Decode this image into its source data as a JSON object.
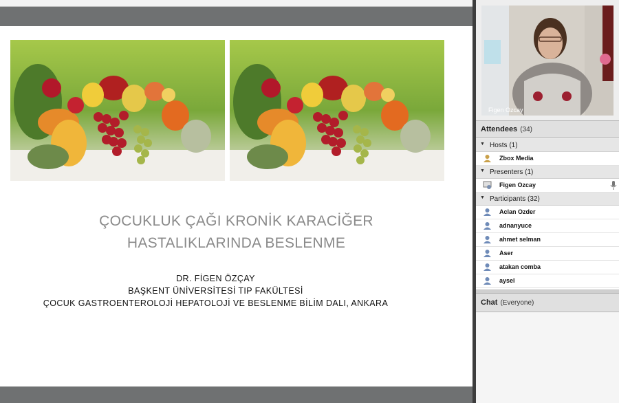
{
  "slide": {
    "title_line1": "ÇOCUKLUK ÇAĞI KRONİK KARACİĞER",
    "title_line2": "HASTALIKLARINDA BESLENME",
    "author": "DR. FİGEN ÖZÇAY",
    "affiliation1": "BAŞKENT ÜNİVERSİTESİ  TIP  FAKÜLTESİ",
    "affiliation2": "ÇOCUK GASTROENTEROLOJİ   HEPATOLOJİ  VE  BESLENME  BİLİM  DALI, ANKARA"
  },
  "video": {
    "name": "Figen Ozcay"
  },
  "attendees": {
    "title": "Attendees",
    "count": "(34)",
    "hosts": {
      "label": "Hosts (1)",
      "items": [
        "Zbox Media"
      ]
    },
    "presenters": {
      "label": "Presenters (1)",
      "items": [
        "Figen Ozcay"
      ]
    },
    "participants": {
      "label": "Participants (32)",
      "items": [
        "Aclan Ozder",
        "adnanyuce",
        "ahmet selman",
        "Aser",
        "atakan comba",
        "aysel"
      ]
    }
  },
  "chat": {
    "title": "Chat",
    "scope": "(Everyone)"
  },
  "colors": {
    "slide_title": "#8a8a8a",
    "toolbar": "#6f7172",
    "panel_header": "#e0e0e0"
  },
  "icons": [
    "host-user-icon",
    "presenter-icon",
    "participant-user-icon",
    "microphone-icon",
    "collapse-arrow-icon"
  ]
}
